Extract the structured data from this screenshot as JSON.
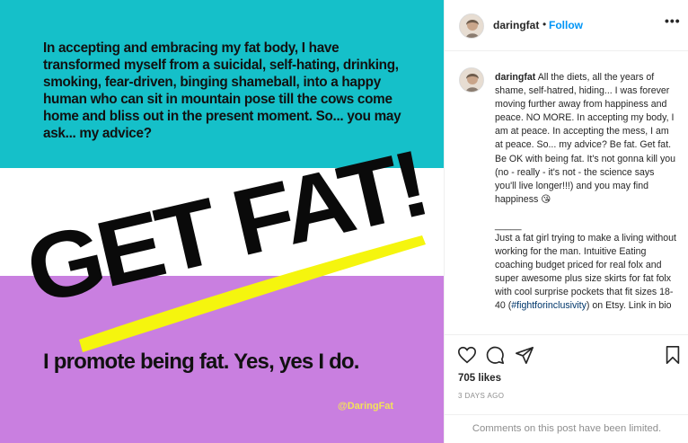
{
  "image": {
    "top_text": "In accepting and embracing my fat body, I have transformed myself from a suicidal, self-hating, drinking, smoking, fear-driven, binging shameball, into a happy human who can sit in mountain pose till the cows come home and bliss out in the present moment. So... you may ask... my advice?",
    "headline": "GET FAT!",
    "bottom_text": "I promote being fat. Yes, yes I do.",
    "handle_tag": "@DaringFat",
    "colors": {
      "teal": "#15c0c9",
      "purple": "#c97fe0",
      "underline_yellow": "#f5f50e",
      "tag_yellow": "#f2e25a"
    }
  },
  "header": {
    "username": "daringfat",
    "separator": "•",
    "follow_label": "Follow",
    "more_icon": "more-horizontal-icon",
    "more_label": "•••"
  },
  "caption": {
    "username": "daringfat",
    "text": "All the diets, all the years of shame, self-hatred, hiding... I was forever moving further away from happiness and peace. NO MORE. In accepting my body, I am at peace. In accepting the mess, I am at peace. So... my advice? Be fat. Get fat. Be OK with being fat. It's not gonna kill you (no - really - it's not - the science says you'll live longer!!!) and you may find happiness",
    "emoji": "😘",
    "separator": "_____",
    "bio_before": "Just a fat girl trying to make a living without working for the man. Intuitive Eating coaching budget priced for real folx and super awesome plus size skirts for fat folx with cool surprise pockets that fit sizes 18-40 (",
    "hashtag": "#fightforinclusivity",
    "bio_after": ") on Etsy. Link in bio"
  },
  "actions": {
    "icons": [
      "heart-icon",
      "comment-icon",
      "share-icon",
      "bookmark-icon"
    ],
    "likes": "705 likes",
    "date": "3 DAYS AGO",
    "comments_limited": "Comments on this post have been limited."
  }
}
